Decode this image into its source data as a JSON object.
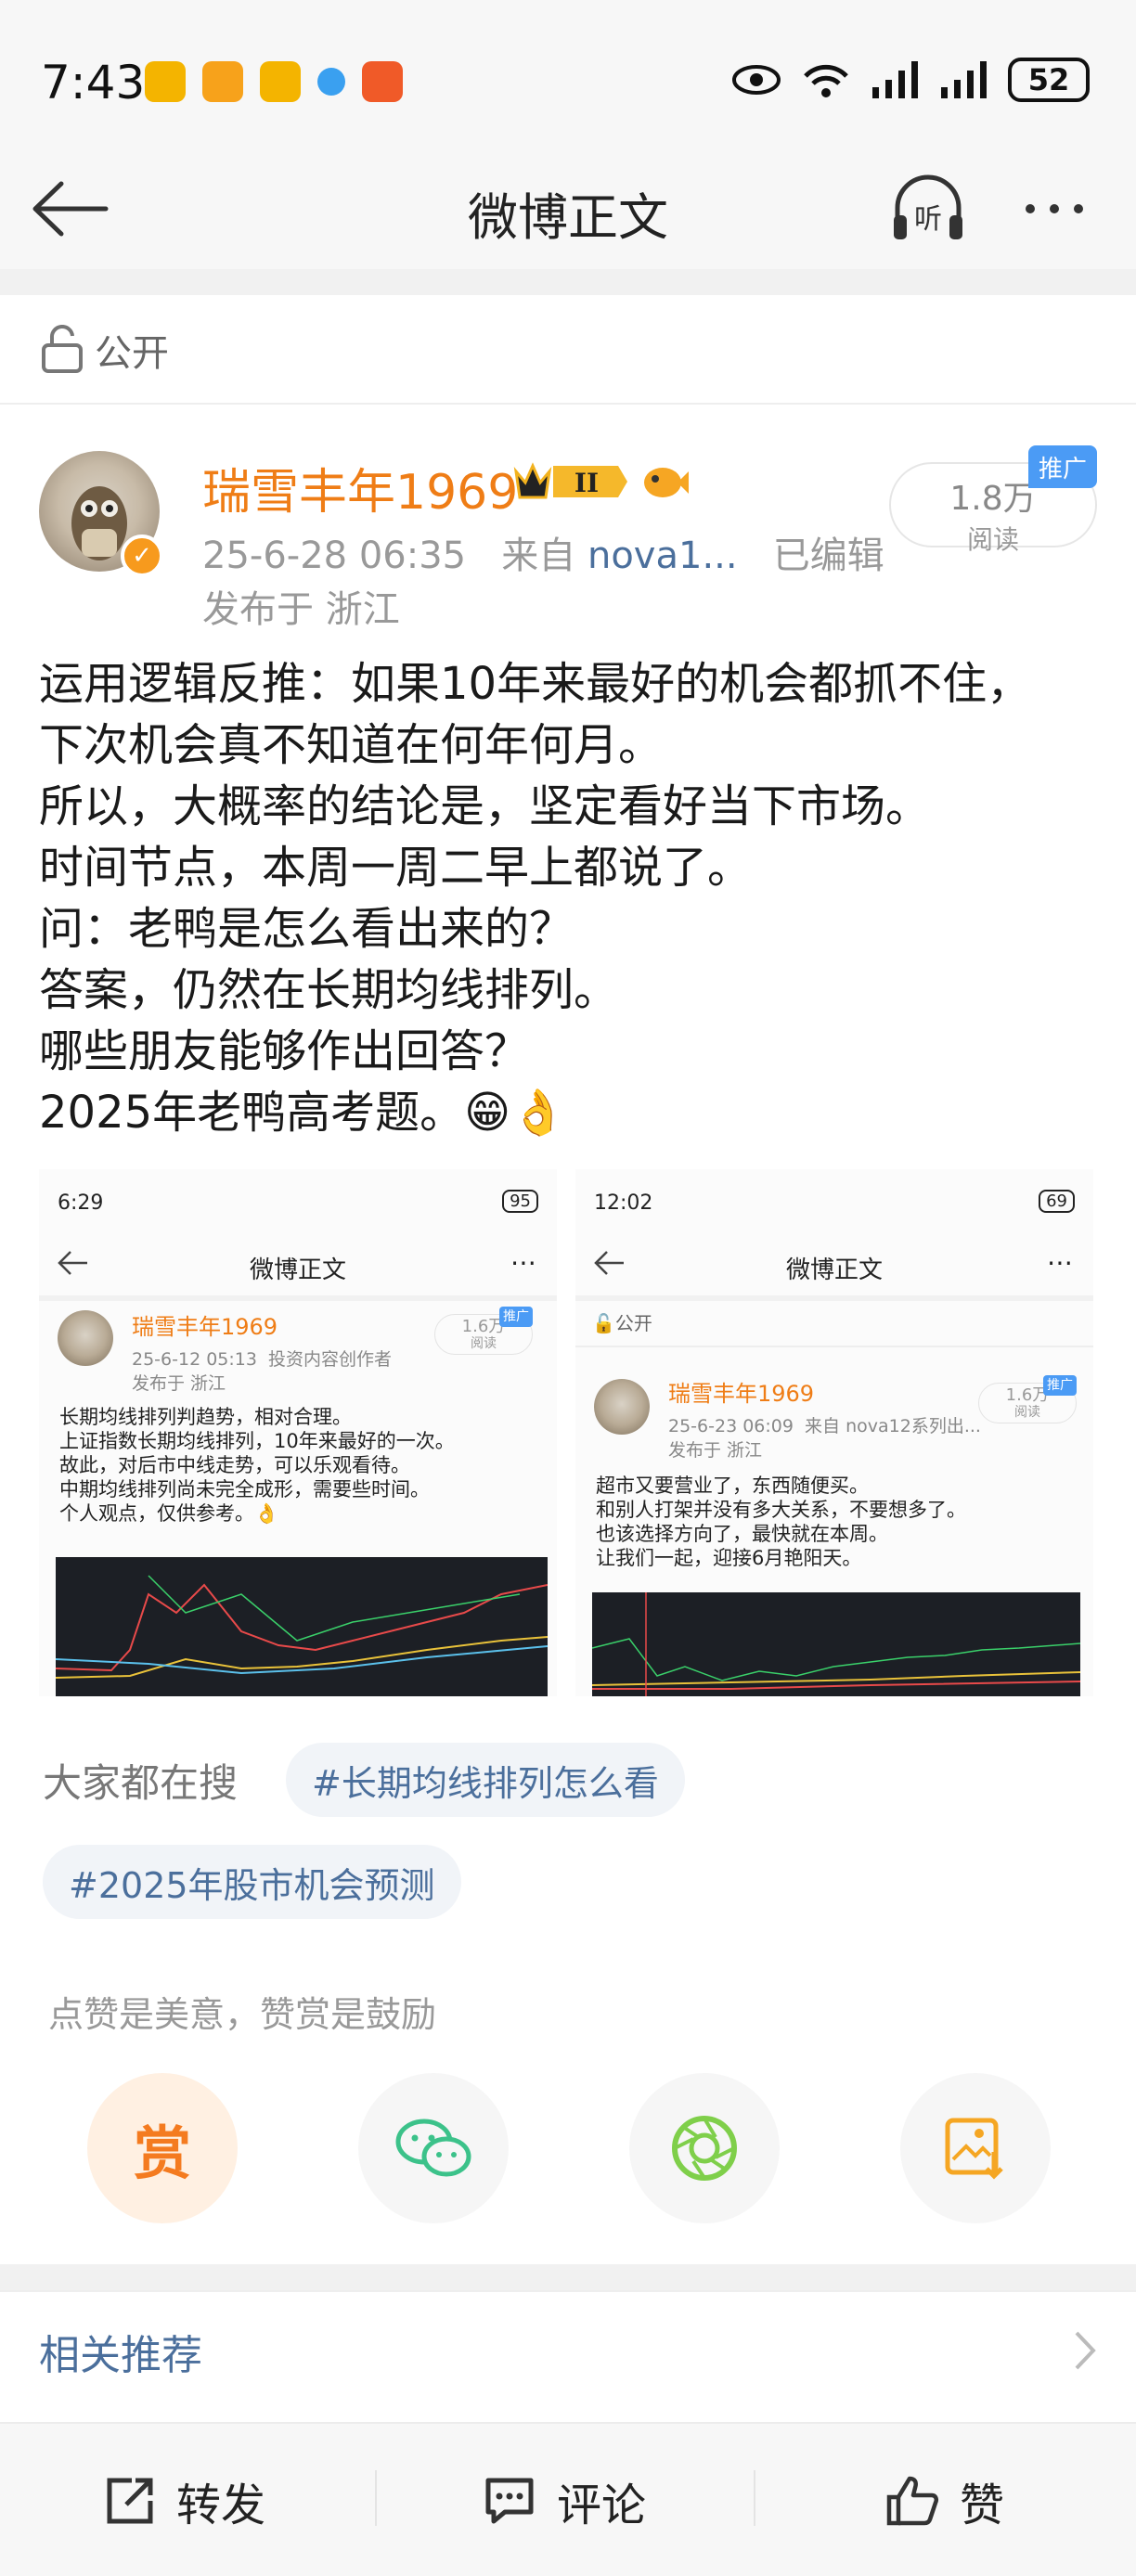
{
  "status_bar": {
    "time": "7:43",
    "battery": "52"
  },
  "nav": {
    "title": "微博正文"
  },
  "post": {
    "visibility": "公开",
    "author": {
      "name": "瑞雪丰年1969",
      "vip_level": "II"
    },
    "meta": {
      "timestamp": "25-6-28 06:35",
      "source_prefix": "来自",
      "source": "nova1...",
      "edited": "已编辑",
      "location": "发布于 浙江"
    },
    "reads": {
      "count": "1.8万",
      "unit": "阅读",
      "ad_label": "推广"
    },
    "body_lines": [
      "运用逻辑反推：如果10年来最好的机会都抓不住，",
      "下次机会真不知道在何年何月。",
      "所以，大概率的结论是，坚定看好当下市场。",
      "时间节点，本周一周二早上都说了。",
      "问：老鸭是怎么看出来的？",
      "答案，仍然在长期均线排列。",
      "哪些朋友能够作出回答？",
      "2025年老鸭高考题。😁👌"
    ],
    "images": [
      {
        "status_time": "6:29",
        "battery": "95",
        "nav_title": "微博正文",
        "author": "瑞雪丰年1969",
        "timestamp": "25-6-12 05:13",
        "source": "投资内容创作者",
        "location": "发布于 浙江",
        "reads": "1.6万",
        "reads_unit": "阅读",
        "ad_label": "推广",
        "lines": [
          "长期均线排列判趋势，相对合理。",
          "上证指数长期均线排列，10年来最好的一次。",
          "故此，对后市中线走势，可以乐观看待。",
          "中期均线排列尚未完全成形，需要些时间。",
          "个人观点，仅供参考。👌"
        ]
      },
      {
        "status_time": "12:02",
        "battery": "69",
        "nav_title": "微博正文",
        "visibility": "公开",
        "author": "瑞雪丰年1969",
        "timestamp": "25-6-23 06:09",
        "source": "来自 nova12系列出...",
        "location": "发布于 浙江",
        "reads": "1.6万",
        "reads_unit": "阅读",
        "ad_label": "推广",
        "lines": [
          "超市又要营业了，东西随便买。",
          "和别人打架并没有多大关系，不要想多了。",
          "也该选择方向了，最快就在本周。",
          "让我们一起，迎接6月艳阳天。"
        ]
      }
    ]
  },
  "search": {
    "label": "大家都在搜",
    "tags": [
      "#长期均线排列怎么看",
      "#2025年股市机会预测"
    ]
  },
  "reward": {
    "hint": "点赞是美意，赞赏是鼓励",
    "reward_label": "赏"
  },
  "related": {
    "label": "相关推荐"
  },
  "bottom_bar": {
    "repost": "转发",
    "comment": "评论",
    "like": "赞"
  },
  "colors": {
    "accent_orange": "#ef7d16",
    "link_blue": "#4b6f9c",
    "wechat_green": "#3cc28a",
    "moments_green": "#7fcf4a",
    "save_orange": "#f5a623"
  }
}
